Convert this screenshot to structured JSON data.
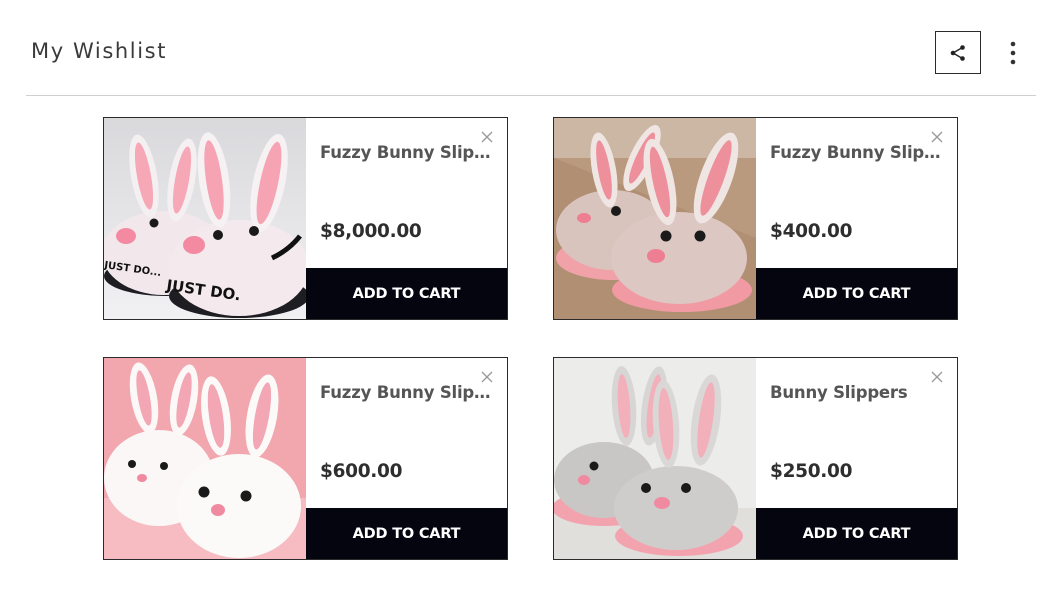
{
  "header": {
    "title": "My Wishlist",
    "share_icon": "share-icon",
    "more_icon": "more-vertical-icon"
  },
  "items": [
    {
      "name": "Fuzzy Bunny Slippers...",
      "price": "$8,000.00",
      "cart_label": "ADD TO CART",
      "image_text": "JUST DO.",
      "image_text_2": "JUST DO..."
    },
    {
      "name": "Fuzzy Bunny Slippers...",
      "price": "$400.00",
      "cart_label": "ADD TO CART"
    },
    {
      "name": "Fuzzy Bunny Slippers...",
      "price": "$600.00",
      "cart_label": "ADD TO CART"
    },
    {
      "name": "Bunny Slippers",
      "price": "$250.00",
      "cart_label": "ADD TO CART"
    }
  ],
  "colors": {
    "button_bg": "#05050f",
    "border": "#2b2b2b",
    "divider": "#cfcfcf"
  }
}
